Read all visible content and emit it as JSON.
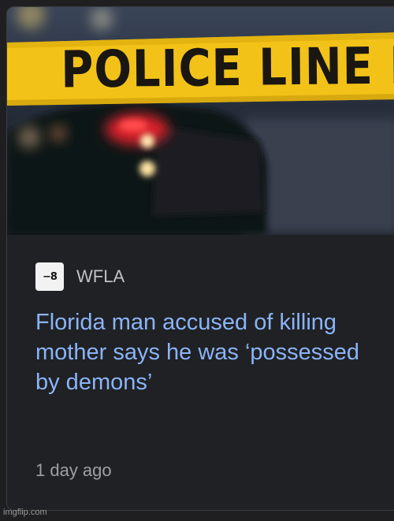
{
  "article": {
    "tape_text": "POLICE LINE DO N",
    "source_name": "WFLA",
    "favicon_text": "−8",
    "headline": "Florida man accused of killing mother says he was ‘possessed by demons’",
    "time_ago": "1 day ago"
  },
  "watermark": "imgflip.com",
  "colors": {
    "headline": "#8ab4f8",
    "tape": "#f2c218",
    "card_bg": "#202124"
  }
}
